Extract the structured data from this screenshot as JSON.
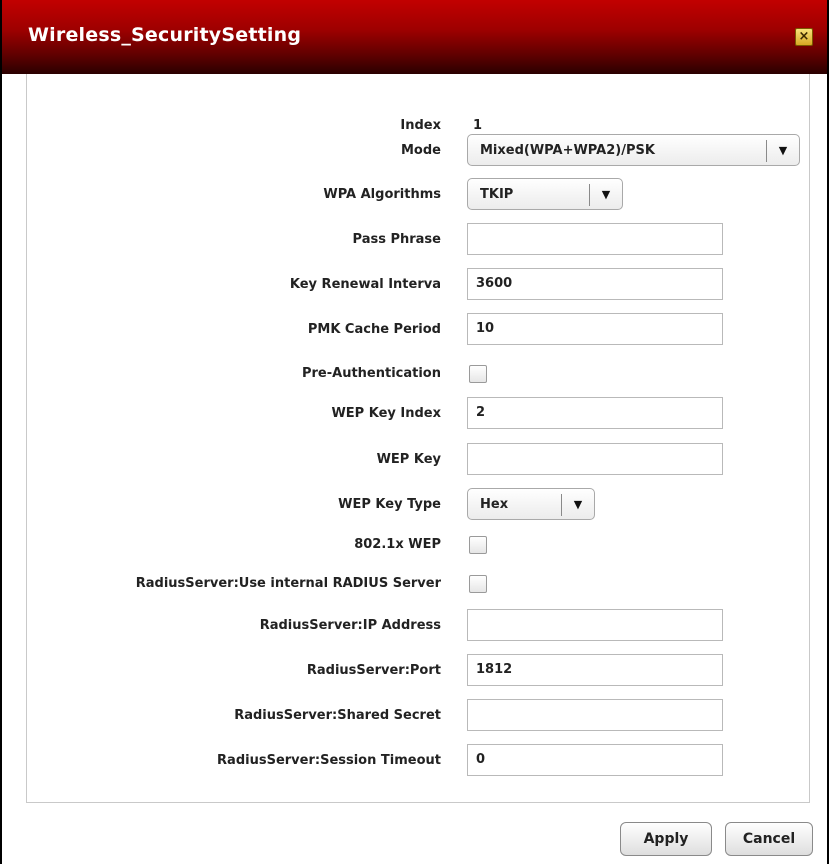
{
  "dialog": {
    "title": "Wireless_SecuritySetting",
    "close_icon": "close-icon"
  },
  "form": {
    "index": {
      "label": "Index",
      "value": "1"
    },
    "mode": {
      "label": "Mode",
      "value": "Mixed(WPA+WPA2)/PSK"
    },
    "wpa_algorithms": {
      "label": "WPA Algorithms",
      "value": "TKIP"
    },
    "pass_phrase": {
      "label": "Pass Phrase",
      "value": ""
    },
    "key_renewal": {
      "label": "Key Renewal Interva",
      "value": "3600"
    },
    "pmk_cache": {
      "label": "PMK Cache Period",
      "value": "10"
    },
    "pre_auth": {
      "label": "Pre-Authentication",
      "checked": false
    },
    "wep_key_index": {
      "label": "WEP Key Index",
      "value": "2"
    },
    "wep_key": {
      "label": "WEP Key",
      "value": ""
    },
    "wep_key_type": {
      "label": "WEP Key Type",
      "value": "Hex"
    },
    "wep_8021x": {
      "label": "802.1x WEP",
      "checked": false
    },
    "radius_internal": {
      "label": "RadiusServer:Use internal RADIUS Server",
      "checked": false
    },
    "radius_ip": {
      "label": "RadiusServer:IP Address",
      "value": ""
    },
    "radius_port": {
      "label": "RadiusServer:Port",
      "value": "1812"
    },
    "radius_secret": {
      "label": "RadiusServer:Shared Secret",
      "value": ""
    },
    "radius_timeout": {
      "label": "RadiusServer:Session Timeout",
      "value": "0"
    }
  },
  "buttons": {
    "apply": "Apply",
    "cancel": "Cancel"
  },
  "colors": {
    "titlebar_top": "#c20000",
    "titlebar_bottom": "#2a0000"
  }
}
